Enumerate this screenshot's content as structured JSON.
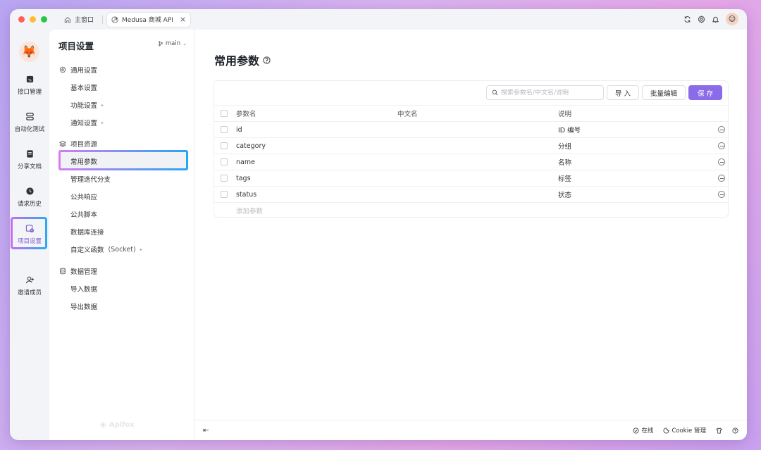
{
  "window": {
    "lights": [
      "#ff5f57",
      "#febc2e",
      "#28c840"
    ],
    "tabs": [
      {
        "label": "主窗口",
        "icon": "home-icon",
        "active": false
      },
      {
        "label": "Medusa 商城 API",
        "icon": "api-icon",
        "active": true
      }
    ],
    "close_glyph": "×"
  },
  "rail": {
    "logo_icon": "fox-avatar-icon",
    "items": [
      {
        "label": "接口管理",
        "icon": "api-management-icon"
      },
      {
        "label": "自动化测试",
        "icon": "automation-test-icon"
      },
      {
        "label": "分享文档",
        "icon": "share-doc-icon"
      },
      {
        "label": "请求历史",
        "icon": "history-icon"
      },
      {
        "label": "项目设置",
        "icon": "project-settings-icon",
        "active": true
      },
      {
        "label": "邀请成员",
        "icon": "invite-member-icon"
      }
    ]
  },
  "sidebar": {
    "title": "项目设置",
    "branch": "main",
    "groups": [
      {
        "label": "通用设置",
        "icon": "gear-icon",
        "items": [
          {
            "label": "基本设置"
          },
          {
            "label": "功能设置",
            "arrow": "▸"
          },
          {
            "label": "通知设置",
            "arrow": "▸"
          }
        ]
      },
      {
        "label": "项目资源",
        "icon": "layers-icon",
        "items": [
          {
            "label": "常用参数",
            "active": true
          },
          {
            "label": "管理迭代分支"
          },
          {
            "label": "公共响应"
          },
          {
            "label": "公共脚本"
          },
          {
            "label": "数据库连接"
          },
          {
            "label": "自定义函数",
            "suffix": "(Socket)",
            "arrow": "▸"
          }
        ]
      },
      {
        "label": "数据管理",
        "icon": "database-icon",
        "items": [
          {
            "label": "导入数据"
          },
          {
            "label": "导出数据"
          }
        ]
      }
    ],
    "watermark": "Apifox"
  },
  "main": {
    "title": "常用参数",
    "search_placeholder": "搜索参数名/中文名/说明",
    "buttons": {
      "import": "导 入",
      "bulk_edit": "批量编辑",
      "save": "保 存"
    },
    "columns": [
      "参数名",
      "中文名",
      "说明"
    ],
    "rows": [
      {
        "name": "id",
        "cn": "",
        "desc": "ID 编号"
      },
      {
        "name": "category",
        "cn": "",
        "desc": "分组"
      },
      {
        "name": "name",
        "cn": "",
        "desc": "名称"
      },
      {
        "name": "tags",
        "cn": "",
        "desc": "标签"
      },
      {
        "name": "status",
        "cn": "",
        "desc": "状态"
      }
    ],
    "add_param": "添加参数"
  },
  "statusbar": {
    "online": "在线",
    "cookie": "Cookie 管理"
  },
  "colors": {
    "accent": "#8b6ce8",
    "highlight_gradient_start": "#c56ef0",
    "highlight_gradient_end": "#2aa9f3"
  }
}
